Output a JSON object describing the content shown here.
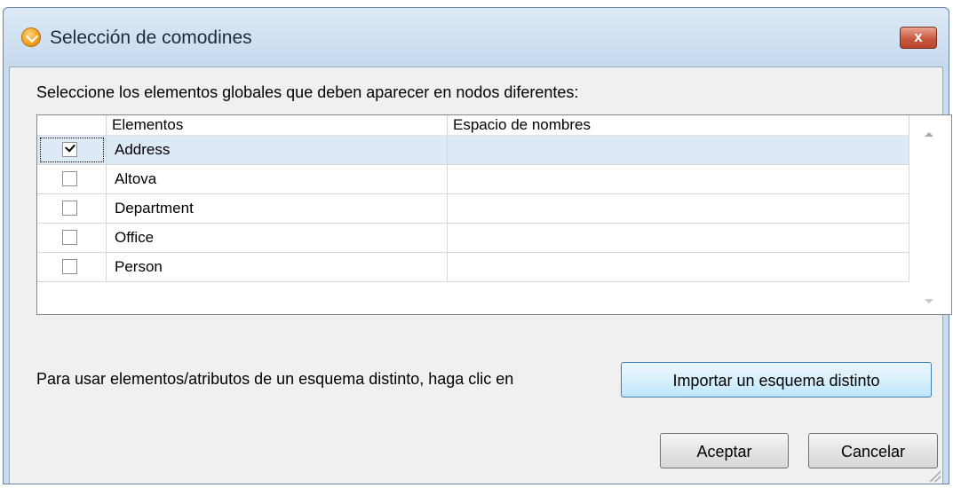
{
  "window": {
    "title": "Selección de comodines",
    "close_label": "x"
  },
  "instruction": "Seleccione los elementos globales que deben aparecer en nodos diferentes:",
  "table": {
    "columns": [
      "Elementos",
      "Espacio de nombres"
    ],
    "rows": [
      {
        "checked": true,
        "name": "Address",
        "namespace": ""
      },
      {
        "checked": false,
        "name": "Altova",
        "namespace": ""
      },
      {
        "checked": false,
        "name": "Department",
        "namespace": ""
      },
      {
        "checked": false,
        "name": "Office",
        "namespace": ""
      },
      {
        "checked": false,
        "name": "Person",
        "namespace": ""
      }
    ]
  },
  "import": {
    "text": "Para usar elementos/atributos de un esquema distinto, haga clic en",
    "button_label": "Importar un esquema distinto"
  },
  "buttons": {
    "ok_label": "Aceptar",
    "cancel_label": "Cancelar"
  },
  "colors": {
    "selected_row": "#dde9f5",
    "titlebar": "#c6daee",
    "close_button": "#c95a3f"
  }
}
